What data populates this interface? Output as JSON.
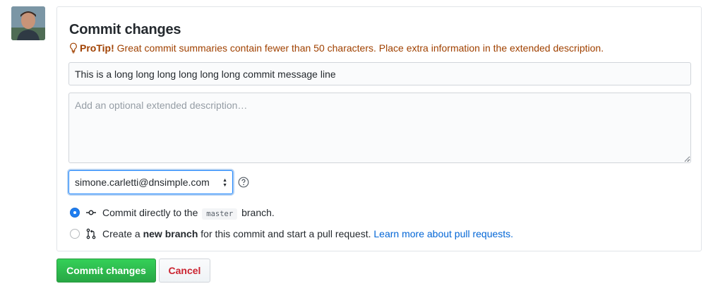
{
  "commit_form": {
    "title": "Commit changes",
    "protip_label": "ProTip!",
    "protip_text": " Great commit summaries contain fewer than 50 characters. Place extra information in the extended description.",
    "summary_value": "This is a long long long long long long commit message line",
    "description_placeholder": "Add an optional extended description…",
    "author_email": "simone.carletti@dnsimple.com",
    "options": {
      "direct": {
        "prefix": "Commit directly to the ",
        "branch": "master",
        "suffix": " branch.",
        "selected": true
      },
      "new_branch": {
        "prefix": "Create a ",
        "bold": "new branch",
        "suffix": " for this commit and start a pull request. ",
        "link": "Learn more about pull requests.",
        "selected": false
      }
    }
  },
  "buttons": {
    "commit_label": "Commit changes",
    "cancel_label": "Cancel"
  },
  "icons": {
    "protip": "light-bulb-icon",
    "help": "question-icon",
    "commit": "git-commit-icon",
    "pull_request": "git-pull-request-icon"
  },
  "colors": {
    "protip": "#a04100",
    "primary_button": "#28a745",
    "cancel_text": "#cb2431",
    "link": "#0366d6",
    "radio_selected": "#1f7ef0"
  }
}
